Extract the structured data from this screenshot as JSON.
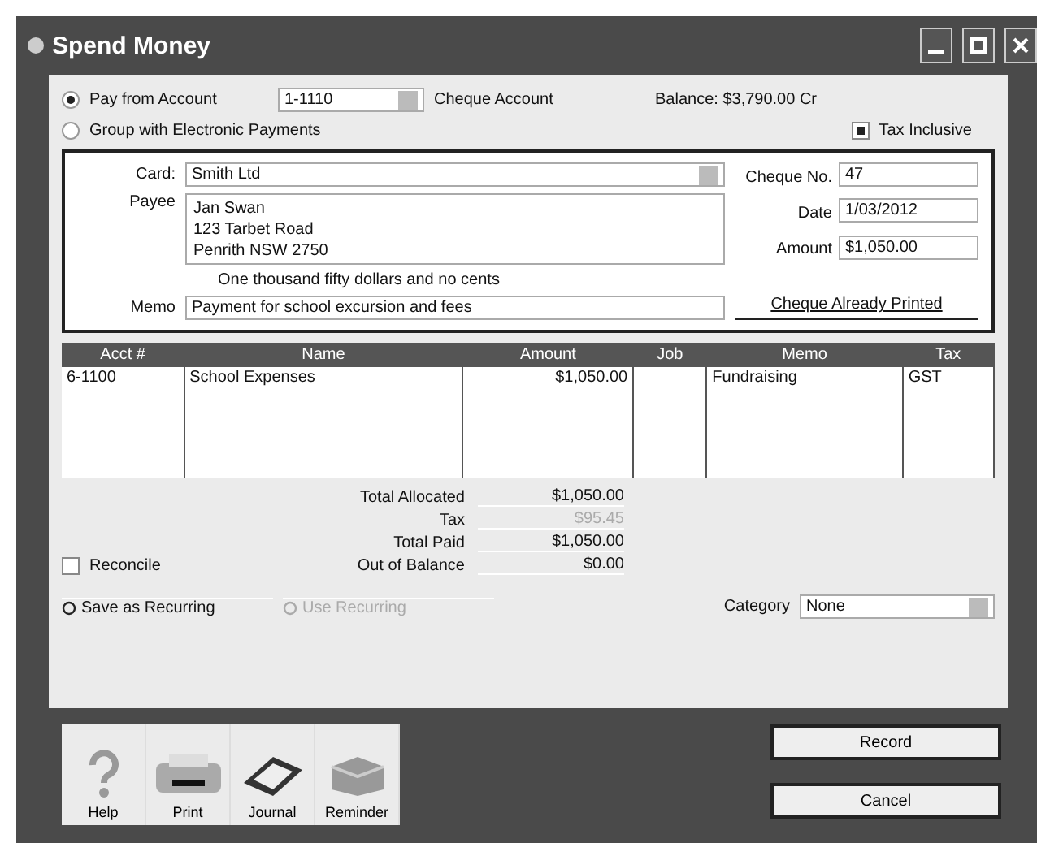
{
  "window": {
    "title": "Spend Money"
  },
  "pay_options": [
    {
      "label": "Pay from Account",
      "selected": true
    },
    {
      "label": "Group with Electronic Payments",
      "selected": false
    }
  ],
  "account": {
    "value": "1-1110",
    "name": "Cheque Account",
    "balance": "Balance: $3,790.00 Cr"
  },
  "tax_inclusive": {
    "label": "Tax Inclusive",
    "checked": true
  },
  "cheque": {
    "card_label": "Card:",
    "card": "Smith Ltd",
    "payee_label": "Payee",
    "payee_lines": [
      "Jan Swan",
      "123 Tarbet Road",
      "Penrith NSW 2750"
    ],
    "amount_words": "One thousand fifty dollars and no cents",
    "memo_label": "Memo",
    "memo": "Payment for school excursion and fees",
    "cheque_no_label": "Cheque No.",
    "cheque_no": "47",
    "date_label": "Date",
    "date": "1/03/2012",
    "amount_label": "Amount",
    "amount": "$1,050.00",
    "printed": "Cheque Already Printed"
  },
  "table": {
    "columns": [
      "Acct #",
      "Name",
      "Amount",
      "Job",
      "Memo",
      "Tax"
    ],
    "rows": [
      [
        "6-1100",
        "School Expenses",
        "$1,050.00",
        "",
        "Fundraising",
        "GST"
      ]
    ]
  },
  "totals": [
    {
      "label": "Total Allocated",
      "value": "$1,050.00",
      "disabled": false
    },
    {
      "label": "Tax",
      "value": "$95.45",
      "disabled": true
    },
    {
      "label": "Total Paid",
      "value": "$1,050.00",
      "disabled": false
    },
    {
      "label": "Out of Balance",
      "value": "$0.00",
      "disabled": false
    }
  ],
  "reconcile": {
    "label": "Reconcile",
    "checked": false
  },
  "recurring": [
    {
      "label": "Save as Recurring",
      "disabled": false
    },
    {
      "label": "Use Recurring",
      "disabled": true
    }
  ],
  "category": {
    "label": "Category",
    "value": "None"
  },
  "tools": [
    {
      "kind": "help",
      "label": "Help"
    },
    {
      "kind": "print",
      "label": "Print"
    },
    {
      "kind": "journal",
      "label": "Journal"
    },
    {
      "kind": "reminder",
      "label": "Reminder"
    }
  ],
  "buttons": [
    "Record",
    "Cancel"
  ]
}
